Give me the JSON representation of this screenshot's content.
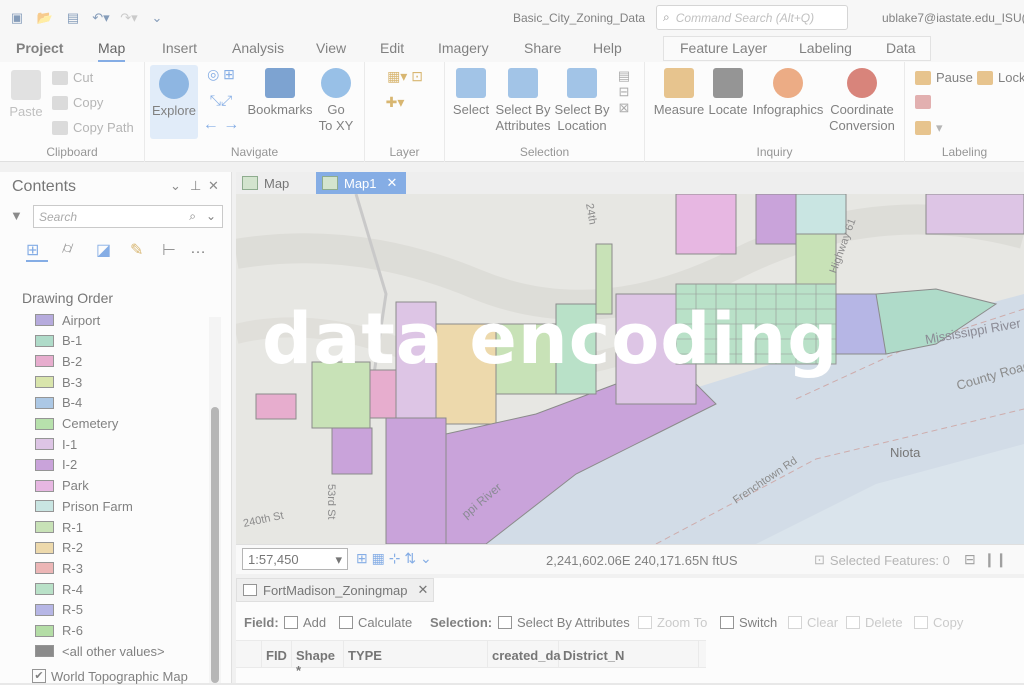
{
  "titlebar": {
    "doc_title": "Basic_City_Zoning_Data",
    "command_search_placeholder": "Command Search (Alt+Q)",
    "user": "ublake7@iastate.edu_ISU("
  },
  "ribbon_tabs": [
    "Project",
    "Map",
    "Insert",
    "Analysis",
    "View",
    "Edit",
    "Imagery",
    "Share",
    "Help"
  ],
  "context_tabs": [
    "Feature Layer",
    "Labeling",
    "Data"
  ],
  "ribbon": {
    "clipboard": {
      "label": "Clipboard",
      "paste": "Paste",
      "cut": "Cut",
      "copy": "Copy",
      "copy_path": "Copy Path"
    },
    "navigate": {
      "label": "Navigate",
      "explore": "Explore",
      "bookmarks": "Bookmarks",
      "goto_xy_1": "Go",
      "goto_xy_2": "To XY"
    },
    "layer": {
      "label": "Layer"
    },
    "selection": {
      "label": "Selection",
      "select": "Select",
      "select_by_attributes_1": "Select By",
      "select_by_attributes_2": "Attributes",
      "select_by_location_1": "Select By",
      "select_by_location_2": "Location"
    },
    "inquiry": {
      "label": "Inquiry",
      "measure": "Measure",
      "locate": "Locate",
      "infographics": "Infographics",
      "coord_conv_1": "Coordinate",
      "coord_conv_2": "Conversion"
    },
    "labeling": {
      "label": "Labeling",
      "pause": "Pause",
      "lock": "Lock"
    }
  },
  "contents": {
    "title": "Contents",
    "search_placeholder": "Search",
    "drawing_order": "Drawing Order",
    "legend": [
      {
        "label": "Airport",
        "color": "#8a78c8"
      },
      {
        "label": "B-1",
        "color": "#7fc6a8"
      },
      {
        "label": "B-2",
        "color": "#d97bb0"
      },
      {
        "label": "B-3",
        "color": "#c2d67a"
      },
      {
        "label": "B-4",
        "color": "#7aa6d6"
      },
      {
        "label": "Cemetery",
        "color": "#8ccf7a"
      },
      {
        "label": "I-1",
        "color": "#c9a2d6"
      },
      {
        "label": "I-2",
        "color": "#a86bc4"
      },
      {
        "label": "Park",
        "color": "#d88bd0"
      },
      {
        "label": "Prison Farm",
        "color": "#a9d6d0"
      },
      {
        "label": "R-1",
        "color": "#a6d18c"
      },
      {
        "label": "R-2",
        "color": "#e2c27a"
      },
      {
        "label": "R-3",
        "color": "#e08a8a"
      },
      {
        "label": "R-4",
        "color": "#8fcfa6"
      },
      {
        "label": "R-5",
        "color": "#8a8ad6"
      },
      {
        "label": "R-6",
        "color": "#86c870"
      },
      {
        "label": "<all other values>",
        "color": "#444444"
      }
    ],
    "basemap_layer": "World Topographic Map"
  },
  "map_tabs": [
    "Map",
    "Map1"
  ],
  "map": {
    "labels": {
      "river1": "Mississippi River",
      "river2": "ppi River",
      "county_road": "County Road",
      "town": "Niota",
      "road_240": "240th St",
      "road_53": "53rd St",
      "frenchtown": "Frenchtown Rd",
      "highway": "Highway 61",
      "road_24": "24th"
    }
  },
  "status": {
    "scale": "1:57,450",
    "coords": "2,241,602.06E 240,171.65N ftUS",
    "selected": "Selected Features: 0"
  },
  "table": {
    "tab_title": "FortMadison_Zoningmap",
    "field_label": "Field:",
    "add": "Add",
    "calculate": "Calculate",
    "selection_label": "Selection:",
    "select_by_attributes": "Select By Attributes",
    "zoom_to": "Zoom To",
    "switch": "Switch",
    "clear": "Clear",
    "delete": "Delete",
    "copy": "Copy",
    "columns": [
      "FID",
      "Shape *",
      "TYPE",
      "created_da",
      "District_N"
    ]
  },
  "watermark": "data encoding"
}
